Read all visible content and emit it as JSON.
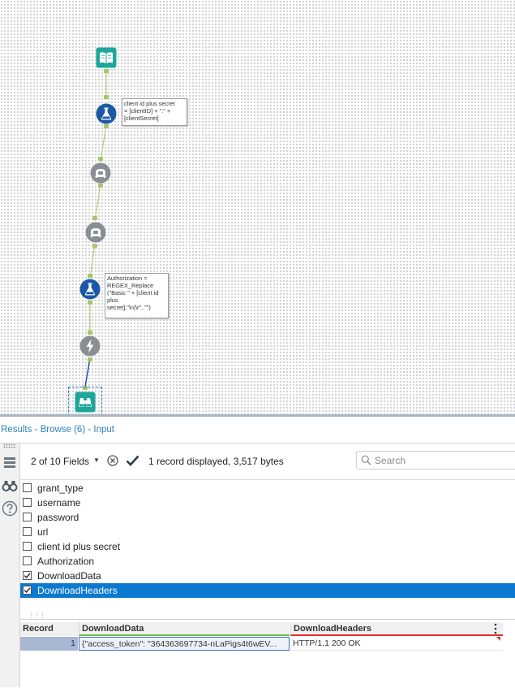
{
  "canvas": {
    "annotations": {
      "formula_1": "client id plus secret\n= [clientID] + \":\" +\n[clientSecret]",
      "formula_2": "Authorization =\nREGEX_Replace\n(\"Basic \" + [client id\nplus\nsecret],\"\\n|\\r\", \"\")"
    },
    "colors": {
      "input_tool": "#1fa69b",
      "formula_tool": "#1b58a6",
      "developer_tool": "#8a8f96",
      "browse_tool": "#1fa69b",
      "connector": "#a8c66a",
      "selected_connector": "#1f3fa8"
    }
  },
  "results": {
    "title": "Results - Browse (6) - Input",
    "toolbar": {
      "fields_count": "2 of 10 Fields",
      "record_info": "1 record displayed, 3,517 bytes",
      "search_placeholder": "Search"
    },
    "fields": [
      {
        "label": "grant_type",
        "checked": false,
        "selected": false
      },
      {
        "label": "username",
        "checked": false,
        "selected": false
      },
      {
        "label": "password",
        "checked": false,
        "selected": false
      },
      {
        "label": "url",
        "checked": false,
        "selected": false
      },
      {
        "label": "client id plus secret",
        "checked": false,
        "selected": false
      },
      {
        "label": "Authorization",
        "checked": false,
        "selected": false
      },
      {
        "label": "DownloadData",
        "checked": true,
        "selected": false
      },
      {
        "label": "DownloadHeaders",
        "checked": true,
        "selected": true
      }
    ],
    "grid": {
      "headers": {
        "record": "Record",
        "data": "DownloadData",
        "headers": "DownloadHeaders"
      },
      "rows": [
        {
          "record": "1",
          "data": "{\"access_token\": \"364363697734-nLaPigs4t6wEV...",
          "headers": "HTTP/1.1 200 OK"
        }
      ]
    }
  }
}
